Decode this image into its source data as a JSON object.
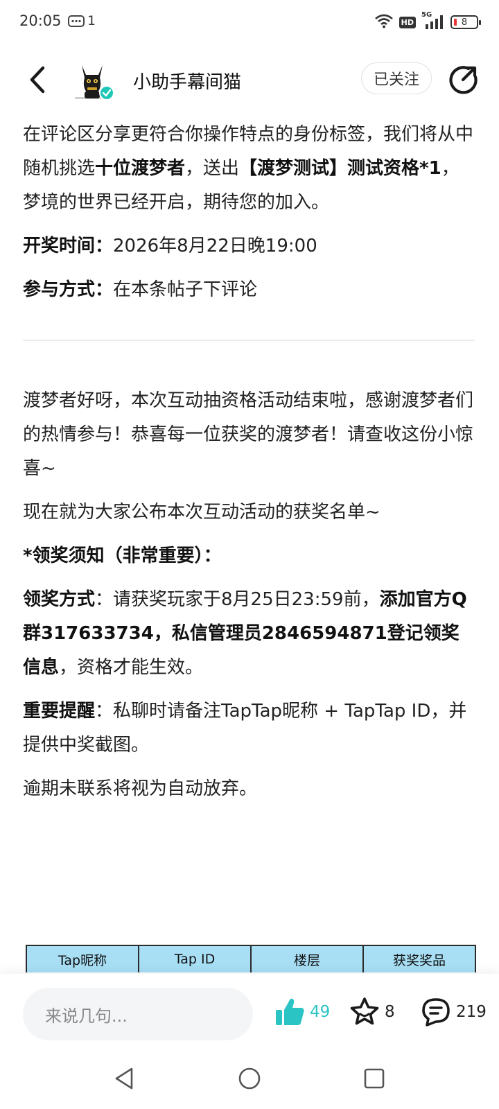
{
  "status_bar": {
    "time": "20:05",
    "message_count": "1",
    "network": "5G",
    "hd": "HD",
    "battery": "8"
  },
  "header": {
    "author_name": "小助手幕间猫",
    "follow_label": "已关注"
  },
  "content": {
    "p1": {
      "t1": "在评论区分享更符合你操作特点的身份标签，我们将从中随机挑选",
      "b1": "十位渡梦者",
      "t2": "，送出",
      "b2": "【渡梦测试】测试资格*1",
      "t3": "，梦境的世界已经开启，期待您的加入。"
    },
    "p2": {
      "label": "开奖时间：",
      "value": "2026年8月22日晚19:00"
    },
    "p3": {
      "label": "参与方式：",
      "value": "在本条帖子下评论"
    },
    "p4": "渡梦者好呀，本次互动抽资格活动结束啦，感谢渡梦者们的热情参与！恭喜每一位获奖的渡梦者！请查收这份小惊喜~",
    "p5": "现在就为大家公布本次互动活动的获奖名单~",
    "p6": "*领奖须知（非常重要）：",
    "p7": {
      "label": "领奖方式",
      "t1": "：请获奖玩家于8月25日23:59前，",
      "b1": "添加官方Q群317633734，私信管理员2846594871登记领奖信息",
      "t2": "，资格才能生效。"
    },
    "p8": {
      "label": "重要提醒",
      "value": "：私聊时请备注TapTap昵称 + TapTap ID，并提供中奖截图。"
    },
    "p9": "逾期未联系将视为自动放弃。"
  },
  "table": {
    "headers": [
      "Tap昵称",
      "Tap ID",
      "楼层",
      "获奖奖品"
    ]
  },
  "bottom_bar": {
    "comment_placeholder": "来说几句...",
    "like_count": "49",
    "favorite_count": "8",
    "comment_count": "219"
  },
  "colors": {
    "accent": "#2bc4c4",
    "table_header_bg": "#a8dff5",
    "verified_badge": "#1fc7b6",
    "battery_low": "#e53935"
  }
}
